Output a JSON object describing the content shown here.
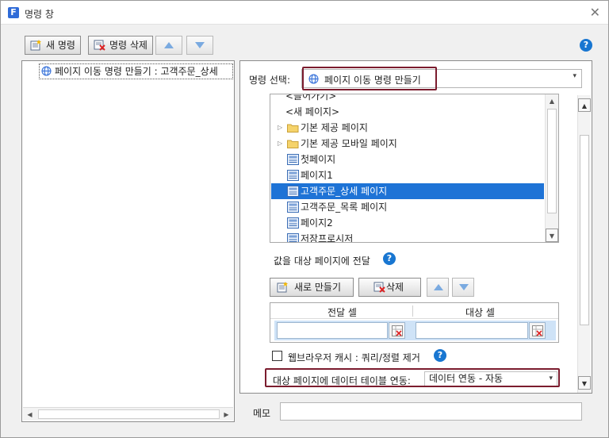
{
  "window": {
    "title": "명령 창"
  },
  "toolbar": {
    "new_command": "새 명령",
    "delete_command": "명령 삭제"
  },
  "left_tree": {
    "root_item": "페이지 이동 명령 만들기 : 고객주문_상세"
  },
  "command_select": {
    "label": "명령 선택:",
    "value": "페이지 이동 명령 만들기"
  },
  "page_list": {
    "items": [
      {
        "label": "<들어가기>",
        "type": "plain"
      },
      {
        "label": "<새 페이지>",
        "type": "plain"
      },
      {
        "label": "기본 제공 페이지",
        "type": "folder"
      },
      {
        "label": "기본 제공 모바일 페이지",
        "type": "folder"
      },
      {
        "label": "첫페이지",
        "type": "page"
      },
      {
        "label": "페이지1",
        "type": "page"
      },
      {
        "label": "고객주문_상세 페이지",
        "type": "page",
        "selected": true
      },
      {
        "label": "고객주문_목록 페이지",
        "type": "page"
      },
      {
        "label": "페이지2",
        "type": "page"
      },
      {
        "label": "저장프로시저",
        "type": "page"
      }
    ]
  },
  "pass_values": {
    "label": "값을 대상 페이지에 전달",
    "new_button": "새로 만들기",
    "delete_button": "삭제",
    "columns": [
      "전달 셀",
      "대상 셀"
    ]
  },
  "cache_option": {
    "label": "웹브라우저 캐시 : 쿼리/정렬 제거",
    "checked": false
  },
  "data_link": {
    "label": "대상 페이지에 데이터 테이블 연동:",
    "value": "데이터 연동 - 자동"
  },
  "memo": {
    "label": "메모",
    "value": ""
  },
  "colors": {
    "accent": "#1e73d6",
    "highlight_outline": "#7b1c2e"
  }
}
